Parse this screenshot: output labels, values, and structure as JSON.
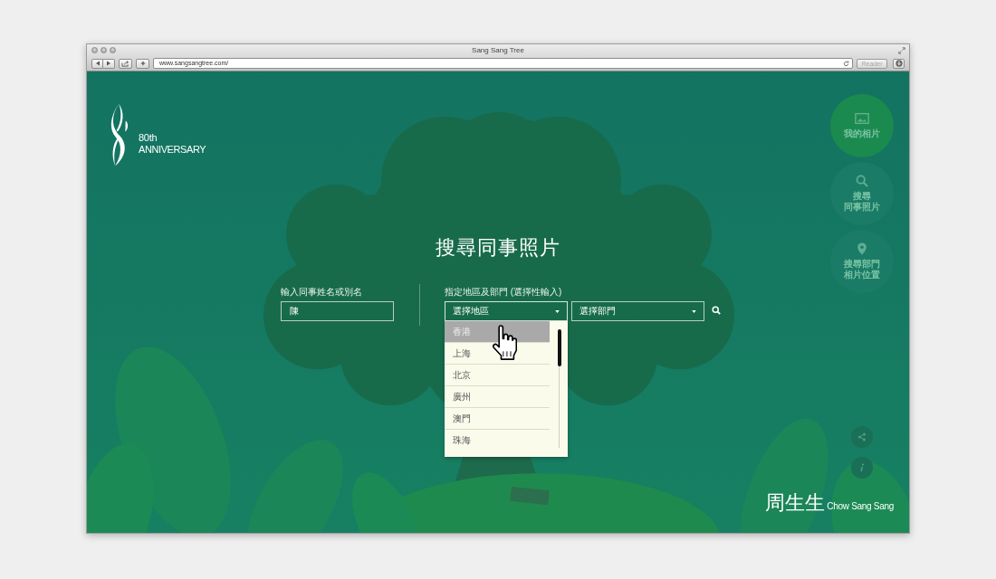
{
  "window": {
    "title": "Sang Sang Tree",
    "url": "www.sangsangtree.com/",
    "reader_button": {
      "label": "Reader",
      "disabled": true
    }
  },
  "logo": {
    "number": "80th",
    "text": "ANNIVERSARY"
  },
  "search": {
    "title": "搜尋同事照片",
    "name_label": "輸入同事姓名或別名",
    "name_value": "陳",
    "filter_label": "指定地區及部門 (選擇性輸入)",
    "region_select": {
      "value": "選擇地區",
      "expanded": true,
      "options": [
        {
          "label": "香港",
          "selected": true
        },
        {
          "label": "上海",
          "selected": false
        },
        {
          "label": "北京",
          "selected": false
        },
        {
          "label": "廣州",
          "selected": false
        },
        {
          "label": "澳門",
          "selected": false
        },
        {
          "label": "珠海",
          "selected": false
        }
      ]
    },
    "department_select": {
      "value": "選擇部門"
    }
  },
  "side_nav": [
    {
      "kind": "photo",
      "label_lines": [
        "我的相片"
      ],
      "color": "#1b8a4f"
    },
    {
      "kind": "search",
      "label_lines": [
        "搜尋",
        "同事照片"
      ],
      "color": "#1a7c66"
    },
    {
      "kind": "pin",
      "label_lines": [
        "搜尋部門",
        "相片位置"
      ],
      "color": "#1a7c66"
    }
  ],
  "brand": {
    "chinese": "周生生",
    "english": "Chow Sang Sang"
  }
}
